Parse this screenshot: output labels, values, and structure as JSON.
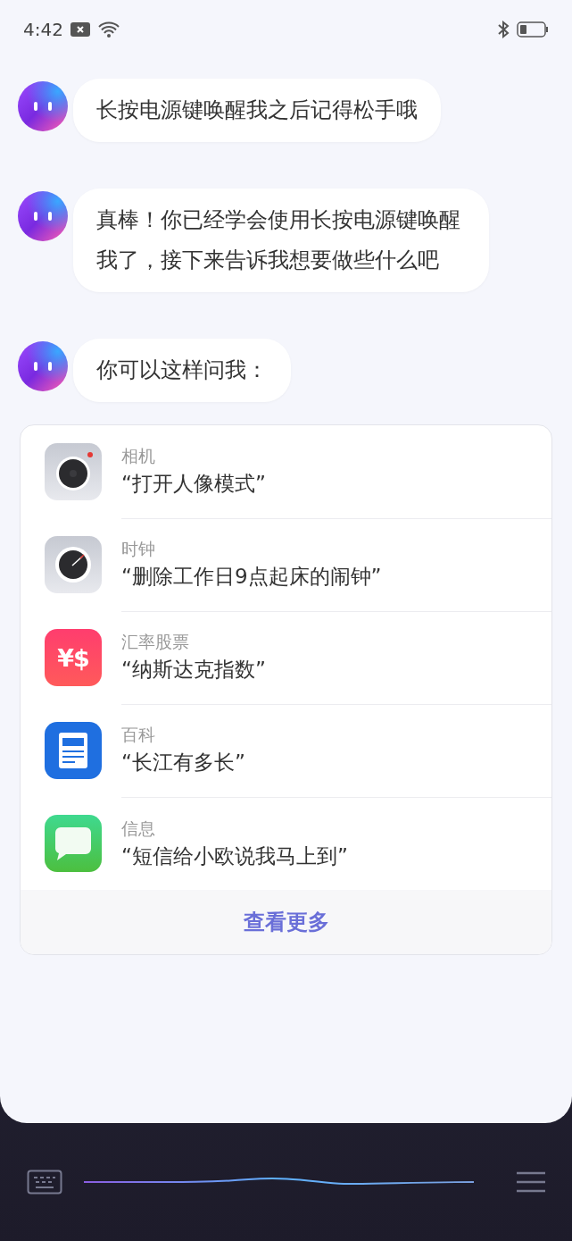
{
  "status_bar": {
    "time": "4:42"
  },
  "messages": [
    {
      "text": "长按电源键唤醒我之后记得松手哦"
    },
    {
      "text": "真棒！你已经学会使用长按电源键唤醒我了，接下来告诉我想要做些什么吧"
    },
    {
      "text": "你可以这样问我："
    }
  ],
  "suggestions": {
    "items": [
      {
        "kind": "camera",
        "app": "相机",
        "query": "“打开人像模式”"
      },
      {
        "kind": "clock",
        "app": "时钟",
        "query": "“删除工作日9点起床的闹钟”"
      },
      {
        "kind": "currency",
        "app": "汇率股票",
        "query": "“纳斯达克指数”",
        "icon_text": "¥$"
      },
      {
        "kind": "encyclopedia",
        "app": "百科",
        "query": "“长江有多长”"
      },
      {
        "kind": "message",
        "app": "信息",
        "query": "“短信给小欧说我马上到”"
      }
    ],
    "more": "查看更多"
  }
}
